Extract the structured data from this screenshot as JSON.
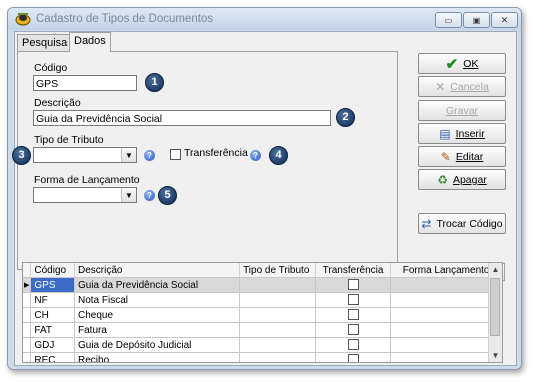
{
  "window": {
    "title": "Cadastro de Tipos de Documentos",
    "controls": {
      "minimize": "▭",
      "maximize": "▣",
      "close": "✕"
    }
  },
  "tabs": [
    {
      "label": "Pesquisa",
      "active": false
    },
    {
      "label": "Dados",
      "active": true
    }
  ],
  "form": {
    "codigo_label": "Código",
    "codigo_value": "GPS",
    "descricao_label": "Descrição",
    "descricao_value": "Guia da Previdência Social",
    "tipo_tributo_label": "Tipo de Tributo",
    "tipo_tributo_value": "",
    "transferencia_label": "Transferência",
    "transferencia_checked": false,
    "forma_lancamento_label": "Forma de Lançamento",
    "forma_lancamento_value": ""
  },
  "badges": [
    "1",
    "2",
    "3",
    "4",
    "5"
  ],
  "help_icon_glyph": "?",
  "buttons": {
    "ok": "OK",
    "cancelar": "Cancela",
    "gravar": "Gravar",
    "inserir": "Inserir",
    "editar": "Editar",
    "apagar": "Apagar",
    "trocar_codigo": "Trocar Código"
  },
  "nav": {
    "first": "|◀",
    "prev": "◀",
    "next": "▶",
    "last": "▶|"
  },
  "grid": {
    "columns": [
      "Código",
      "Descrição",
      "Tipo de Tributo",
      "Transferência",
      "Forma Lançamento"
    ],
    "rows": [
      {
        "codigo": "GPS",
        "descricao": "Guia da Previdência Social",
        "tipo_tributo": "",
        "transferencia": false,
        "forma": ""
      },
      {
        "codigo": "NF",
        "descricao": "Nota Fiscal",
        "tipo_tributo": "",
        "transferencia": false,
        "forma": ""
      },
      {
        "codigo": "CH",
        "descricao": "Cheque",
        "tipo_tributo": "",
        "transferencia": false,
        "forma": ""
      },
      {
        "codigo": "FAT",
        "descricao": "Fatura",
        "tipo_tributo": "",
        "transferencia": false,
        "forma": ""
      },
      {
        "codigo": "GDJ",
        "descricao": "Guia de Depósito Judicial",
        "tipo_tributo": "",
        "transferencia": false,
        "forma": ""
      },
      {
        "codigo": "REC",
        "descricao": "Recibo",
        "tipo_tributo": "",
        "transferencia": false,
        "forma": ""
      }
    ],
    "selected_index": 0
  },
  "colors": {
    "title_bg": "#c3d4e8",
    "panel_bg": "#f0f0f0",
    "selected_cell": "#3b6dc7",
    "badge": "#0b2a55",
    "ok_check": "#1f8a1f"
  }
}
